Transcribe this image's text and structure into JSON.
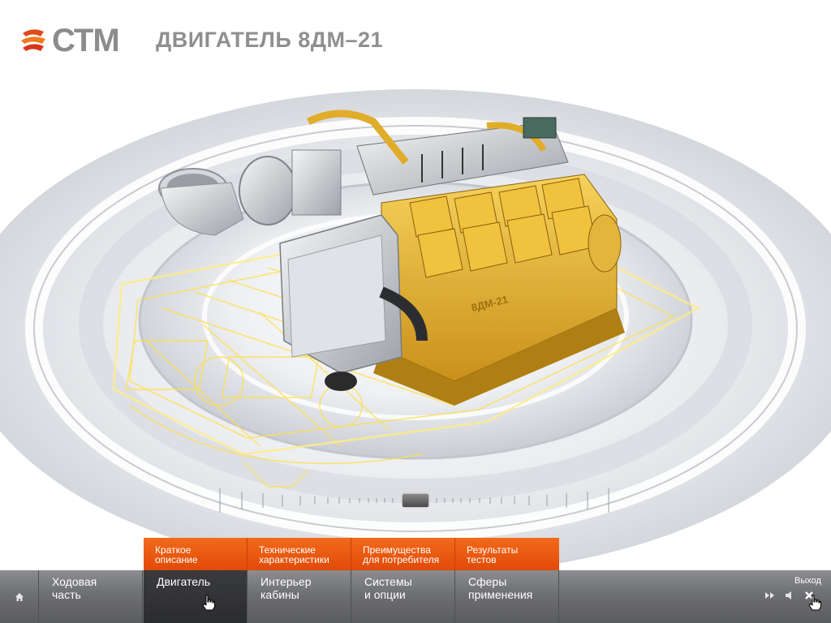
{
  "header": {
    "logo_text": "СТМ",
    "title": "ДВИГАТЕЛЬ 8ДМ–21"
  },
  "engine": {
    "plate_label": "8ДМ-21"
  },
  "submenu": {
    "items": [
      {
        "line1": "Краткое",
        "line2": "описание"
      },
      {
        "line1": "Технические",
        "line2": "характеристики"
      },
      {
        "line1": "Преимущества",
        "line2": "для потребителя"
      },
      {
        "line1": "Результаты",
        "line2": "тестов"
      }
    ]
  },
  "nav": {
    "items": [
      {
        "line1": "Ходовая",
        "line2": "часть"
      },
      {
        "line1": "Двигатель",
        "line2": ""
      },
      {
        "line1": "Интерьер",
        "line2": "кабины"
      },
      {
        "line1": "Системы",
        "line2": "и опции"
      },
      {
        "line1": "Сферы",
        "line2": "применения"
      }
    ],
    "active_index": 1
  },
  "controls": {
    "exit_label": "Выход",
    "icons": [
      "home-icon",
      "fast-forward-icon",
      "sound-icon",
      "close-icon"
    ]
  },
  "timeline": {
    "position_fraction": 0.5
  },
  "colors": {
    "accent_orange": "#e85a12",
    "bar_gray": "#6e6f73",
    "active_dark": "#2e2f32",
    "engine_yellow": "#e8b830",
    "wireframe_yellow": "#ffe04a"
  }
}
